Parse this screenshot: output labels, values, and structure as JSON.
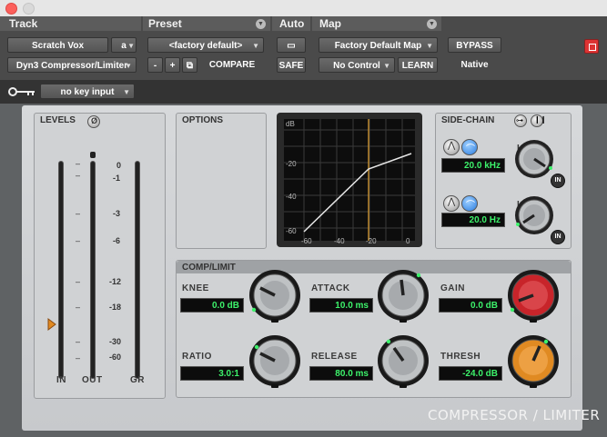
{
  "header": {
    "track_label": "Track",
    "preset_label": "Preset",
    "auto_label": "Auto",
    "map_label": "Map",
    "track_name": "Scratch Vox",
    "track_channel": "a",
    "plugin_name": "Dyn3 Compressor/Limiter",
    "preset_value": "<factory default>",
    "preset_minus": "-",
    "preset_plus": "+",
    "compare_label": "COMPARE",
    "safe_label": "SAFE",
    "map_value": "Factory Default Map",
    "control_value": "No Control",
    "learn_label": "LEARN",
    "bypass_label": "BYPASS",
    "native_label": "Native"
  },
  "keyrow": {
    "key_input_value": "no key input"
  },
  "levels": {
    "title": "LEVELS",
    "scale": [
      "0",
      "-1",
      "-3",
      "-6",
      "-12",
      "-18",
      "-30",
      "-60"
    ],
    "labels": [
      "IN",
      "OUT",
      "GR"
    ]
  },
  "options": {
    "title": "OPTIONS"
  },
  "graph": {
    "y_ticks": [
      "dB",
      "-20",
      "-40",
      "-60"
    ],
    "x_ticks": [
      "-60",
      "-40",
      "-20",
      "0"
    ]
  },
  "sidechain": {
    "title": "SIDE-CHAIN",
    "hf_label": "HF",
    "hf_value": "20.0 kHz",
    "lf_label": "LF",
    "lf_value": "20.0 Hz",
    "in_label": "IN"
  },
  "complimit": {
    "title": "COMP/LIMIT",
    "knee_label": "KNEE",
    "knee_value": "0.0 dB",
    "attack_label": "ATTACK",
    "attack_value": "10.0 ms",
    "gain_label": "GAIN",
    "gain_value": "0.0 dB",
    "ratio_label": "RATIO",
    "ratio_value": "3.0:1",
    "release_label": "RELEASE",
    "release_value": "80.0 ms",
    "thresh_label": "THRESH",
    "thresh_value": "-24.0 dB"
  },
  "footer": {
    "plugin_title": "COMPRESSOR / LIMITER"
  },
  "colors": {
    "lcd_text": "#3df26b",
    "gain_knob": "#c8242a",
    "thresh_knob": "#e08a22",
    "threshold_line": "#e0a030",
    "sidechain_filter_blue": "#2b7de0"
  }
}
